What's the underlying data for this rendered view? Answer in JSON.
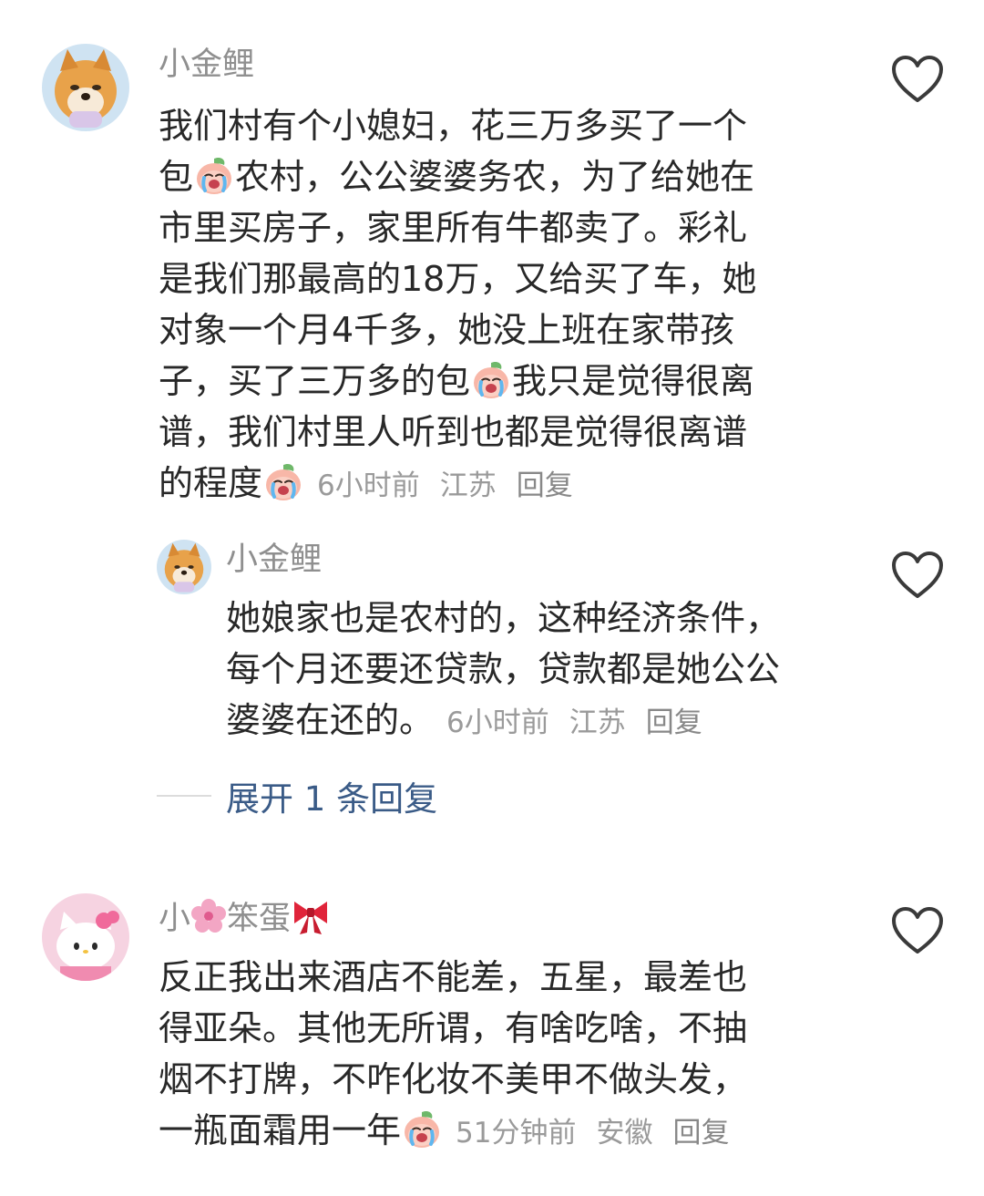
{
  "comments": [
    {
      "username": "小金鲤",
      "lines": [
        [
          "我们村有个小媳妇，花三万多买了一个"
        ],
        [
          "包",
          "[emoji]",
          "农村，公公婆婆务农，为了给她在"
        ],
        [
          "市里买房子，家里所有牛都卖了。彩礼"
        ],
        [
          "是我们那最高的18万，又给买了车，她"
        ],
        [
          "对象一个月4千多，她没上班在家带孩"
        ],
        [
          "子，买了三万多的包",
          "[emoji]",
          "我只是觉得很离"
        ],
        [
          "谱，我们村里人听到也都是觉得很离谱"
        ],
        [
          "的程度",
          "[emoji]"
        ]
      ],
      "time": "6小时前",
      "location": "江苏",
      "reply_label": "回复",
      "avatar_icon": "shiba-dog-avatar",
      "like_icon": "heart-outline-icon"
    }
  ],
  "reply": {
    "username": "小金鲤",
    "lines": [
      "她娘家也是农村的，这种经济条件，",
      "每个月还要还贷款，贷款都是她公公",
      "婆婆在还的。"
    ],
    "time": "6小时前",
    "location": "江苏",
    "reply_label": "回复",
    "avatar_icon": "shiba-dog-avatar",
    "like_icon": "heart-outline-icon"
  },
  "expand": {
    "label": "展开 1 条回复"
  },
  "comment2": {
    "username_parts": [
      "小",
      "[sakura]",
      "笨蛋",
      "[bow]"
    ],
    "lines": [
      "反正我出来酒店不能差，五星，最差也",
      "得亚朵。其他无所谓，有啥吃啥，不抽",
      "烟不打牌，不咋化妆不美甲不做头发，",
      "一瓶面霜用一年"
    ],
    "time": "51分钟前",
    "location": "安徽",
    "reply_label": "回复",
    "avatar_icon": "hello-kitty-avatar",
    "like_icon": "heart-outline-icon"
  },
  "colors": {
    "username": "#8f8f8f",
    "body": "#282828",
    "meta": "#9a9a9a",
    "expand_link": "#3a5b87"
  }
}
